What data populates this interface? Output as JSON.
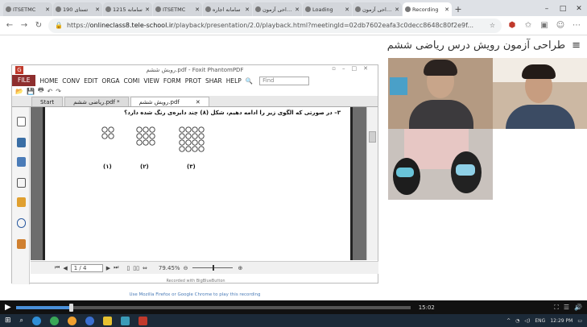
{
  "browser": {
    "tabs": [
      {
        "label": "ITSETMC",
        "active": false
      },
      {
        "label": "190 تستای",
        "active": false
      },
      {
        "label": "1215 سامانه",
        "active": false
      },
      {
        "label": "ITSETMC",
        "active": false
      },
      {
        "label": "سامانه اجاره",
        "active": false
      },
      {
        "label": "طراحی آزمون",
        "active": false
      },
      {
        "label": "Loading",
        "active": false
      },
      {
        "label": "طراحی آزمون",
        "active": false
      },
      {
        "label": "Recording",
        "active": true
      }
    ],
    "new_tab": "+",
    "url_prefix": "https://",
    "url_host": "onlineclass8.tele-school.ir",
    "url_path": "/playback/presentation/2.0/playback.html?meetingId=02db7602eafa3c0decc8648c80f2e9f...",
    "window_controls": [
      "–",
      "□",
      "✕"
    ]
  },
  "page": {
    "title": "طراحی آزمون رویش درس ریاضی ششم",
    "menu_icon": "≡"
  },
  "pdf_app": {
    "window_title": "رویش ششم.pdf - Foxit PhantomPDF",
    "logo": "G",
    "ribbon": [
      "HOME",
      "CONV",
      "EDIT",
      "ORGA",
      "COMI",
      "VIEW",
      "FORM",
      "PROT",
      "SHAR",
      "HELP"
    ],
    "file_label": "FILE",
    "find_placeholder": "Find",
    "doc_tabs": [
      {
        "label": "Start",
        "active": false
      },
      {
        "label": "ریاضی ششم.pdf *",
        "active": false
      },
      {
        "label": "رویش ششم.pdf",
        "active": true
      }
    ],
    "question": "۳– در صورتی که الگوی زیر را ادامه دهیم، شکل (۸) چند دایره‌ی رنگ شده دارد؟",
    "figure_labels": [
      "(۱)",
      "(۲)",
      "(۳)"
    ],
    "page_field": "1 / 4",
    "zoom": "79.45%",
    "recorded_with": "Recorded with BigBlueButton"
  },
  "hint": "Use Mozilla Firefox or Google Chrome to play this recording",
  "player": {
    "progress_fraction": 0.14,
    "time": "15:02"
  },
  "taskbar": {
    "lang": "ENG",
    "clock": "12:29 PM"
  },
  "colors": {
    "accent": "#4a90d9",
    "foxit_red": "#8e2e2e",
    "taskbar": "#1c2a38"
  }
}
